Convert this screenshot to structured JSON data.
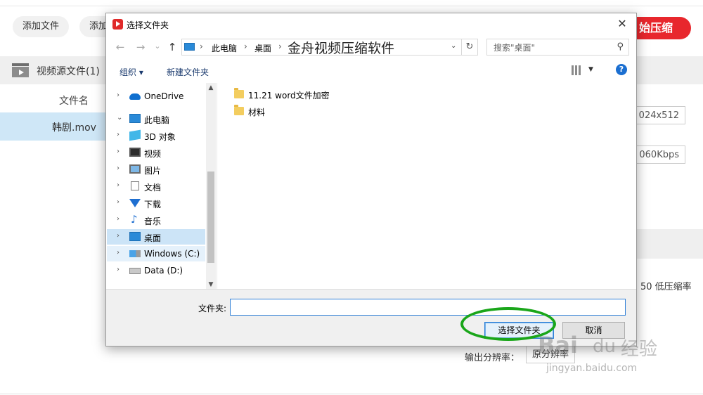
{
  "background_app": {
    "add_file_label": "添加文件",
    "add_folder_label": "添加",
    "start_compress_label": "始压缩",
    "source_files_title": "视频源文件(1)",
    "file_name_header": "文件名",
    "file_name": "韩剧.mov",
    "resolution_value": "024x512",
    "bitrate_value": "060Kbps",
    "compression_ratio_text": "50  低压缩率",
    "output_resolution_label": "输出分辨率：",
    "output_resolution_value": "原分辨率",
    "accent_color": "#e8272d"
  },
  "dialog": {
    "title": "选择文件夹",
    "close_glyph": "✕",
    "nav": {
      "back_glyph": "←",
      "forward_glyph": "→",
      "recent_glyph": "⌄",
      "up_glyph": "↑"
    },
    "address": {
      "crumbs": [
        "此电脑",
        "桌面"
      ],
      "separator": "›",
      "current_folder": "金舟视频压缩软件",
      "dropdown_glyph": "⌄",
      "refresh_glyph": "↻"
    },
    "search": {
      "placeholder": "搜索\"桌面\"",
      "icon_glyph": "⚲"
    },
    "toolbar": {
      "organize_label": "组织 ▾",
      "new_folder_label": "新建文件夹",
      "view_drop_glyph": "▼",
      "help_glyph": "?"
    },
    "nav_pane": {
      "items": [
        {
          "label": "OneDrive",
          "chevron": "›"
        },
        {
          "label": "此电脑",
          "chevron": "⌄"
        },
        {
          "label": "3D 对象",
          "chevron": "›"
        },
        {
          "label": "视频",
          "chevron": "›"
        },
        {
          "label": "图片",
          "chevron": "›"
        },
        {
          "label": "文档",
          "chevron": "›"
        },
        {
          "label": "下载",
          "chevron": "›"
        },
        {
          "label": "音乐",
          "chevron": "›"
        },
        {
          "label": "桌面",
          "chevron": "›"
        },
        {
          "label": "Windows (C:)",
          "chevron": "›"
        },
        {
          "label": "Data (D:)",
          "chevron": "›"
        }
      ],
      "scroll_up_glyph": "▲",
      "scroll_down_glyph": "▼",
      "music_glyph": "♪"
    },
    "files": [
      {
        "name": "11.21 word文件加密"
      },
      {
        "name": "材料"
      }
    ],
    "folder_field_label": "文件夹:",
    "folder_field_value": "",
    "select_button_label": "选择文件夹",
    "cancel_button_label": "取消"
  },
  "watermark": {
    "logo_text": "Bai",
    "logo_paw": "du",
    "logo_cn": "经验",
    "url": "jingyan.baidu.com"
  },
  "annotation_color": "#1aa61a"
}
